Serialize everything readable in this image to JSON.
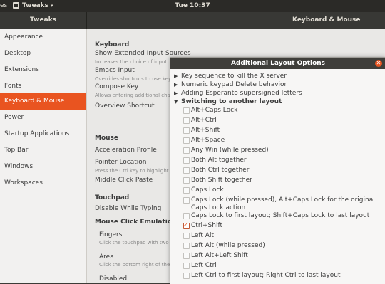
{
  "top_panel": {
    "activities": "es",
    "app_name": "Tweaks",
    "app_caret": "▾",
    "clock": "Tue 10:37"
  },
  "header": {
    "left_title": "Tweaks",
    "right_title": "Keyboard & Mouse"
  },
  "sidebar": {
    "items": [
      {
        "label": "Appearance"
      },
      {
        "label": "Desktop"
      },
      {
        "label": "Extensions"
      },
      {
        "label": "Fonts"
      },
      {
        "label": "Keyboard & Mouse",
        "active": true
      },
      {
        "label": "Power"
      },
      {
        "label": "Startup Applications"
      },
      {
        "label": "Top Bar"
      },
      {
        "label": "Windows"
      },
      {
        "label": "Workspaces"
      }
    ]
  },
  "main": {
    "keyboard_section": "Keyboard",
    "show_extended": "Show Extended Input Sources",
    "show_extended_desc": "Increases the choice of input",
    "emacs_input": "Emacs Input",
    "emacs_desc": "Overrides shortcuts to use keyb",
    "compose_key": "Compose Key",
    "compose_desc": "Allows entering additional chara",
    "overview_shortcut": "Overview Shortcut",
    "mouse_section": "Mouse",
    "acceleration_profile": "Acceleration Profile",
    "pointer_location": "Pointer Location",
    "pointer_desc": "Press the Ctrl key to highlight th",
    "middle_click": "Middle Click Paste",
    "touchpad_section": "Touchpad",
    "disable_typing": "Disable While Typing",
    "mouse_click_emulation": "Mouse Click Emulation",
    "fingers": "Fingers",
    "fingers_desc": "Click the touchpad with two fi",
    "area": "Area",
    "area_desc": "Click the bottom right of the t",
    "disabled": "Disabled"
  },
  "dialog": {
    "title": "Additional Layout Options",
    "close_glyph": "✕",
    "collapsed_glyph": "▶",
    "expanded_glyph": "▼",
    "groups": [
      {
        "label": "Key sequence to kill the X server"
      },
      {
        "label": "Numeric keypad Delete behavior"
      },
      {
        "label": "Adding Esperanto supersigned letters"
      },
      {
        "label": "Switching to another layout"
      }
    ],
    "options": [
      {
        "label": "Alt+Caps Lock",
        "checked": false
      },
      {
        "label": "Alt+Ctrl",
        "checked": false
      },
      {
        "label": "Alt+Shift",
        "checked": false
      },
      {
        "label": "Alt+Space",
        "checked": false
      },
      {
        "label": "Any Win (while pressed)",
        "checked": false
      },
      {
        "label": "Both Alt together",
        "checked": false
      },
      {
        "label": "Both Ctrl together",
        "checked": false
      },
      {
        "label": "Both Shift together",
        "checked": false
      },
      {
        "label": "Caps Lock",
        "checked": false
      },
      {
        "label": "Caps Lock (while pressed), Alt+Caps Lock for the original Caps Lock action",
        "checked": false
      },
      {
        "label": "Caps Lock to first layout; Shift+Caps Lock to last layout",
        "checked": false
      },
      {
        "label": "Ctrl+Shift",
        "checked": true
      },
      {
        "label": "Left Alt",
        "checked": false
      },
      {
        "label": "Left Alt (while pressed)",
        "checked": false
      },
      {
        "label": "Left Alt+Left Shift",
        "checked": false
      },
      {
        "label": "Left Ctrl",
        "checked": false
      },
      {
        "label": "Left Ctrl to first layout; Right Ctrl to last layout",
        "checked": false
      }
    ]
  },
  "colors": {
    "accent": "#e95420",
    "panel": "#2b2a27",
    "sidebar_bg": "#f2f1f0"
  }
}
